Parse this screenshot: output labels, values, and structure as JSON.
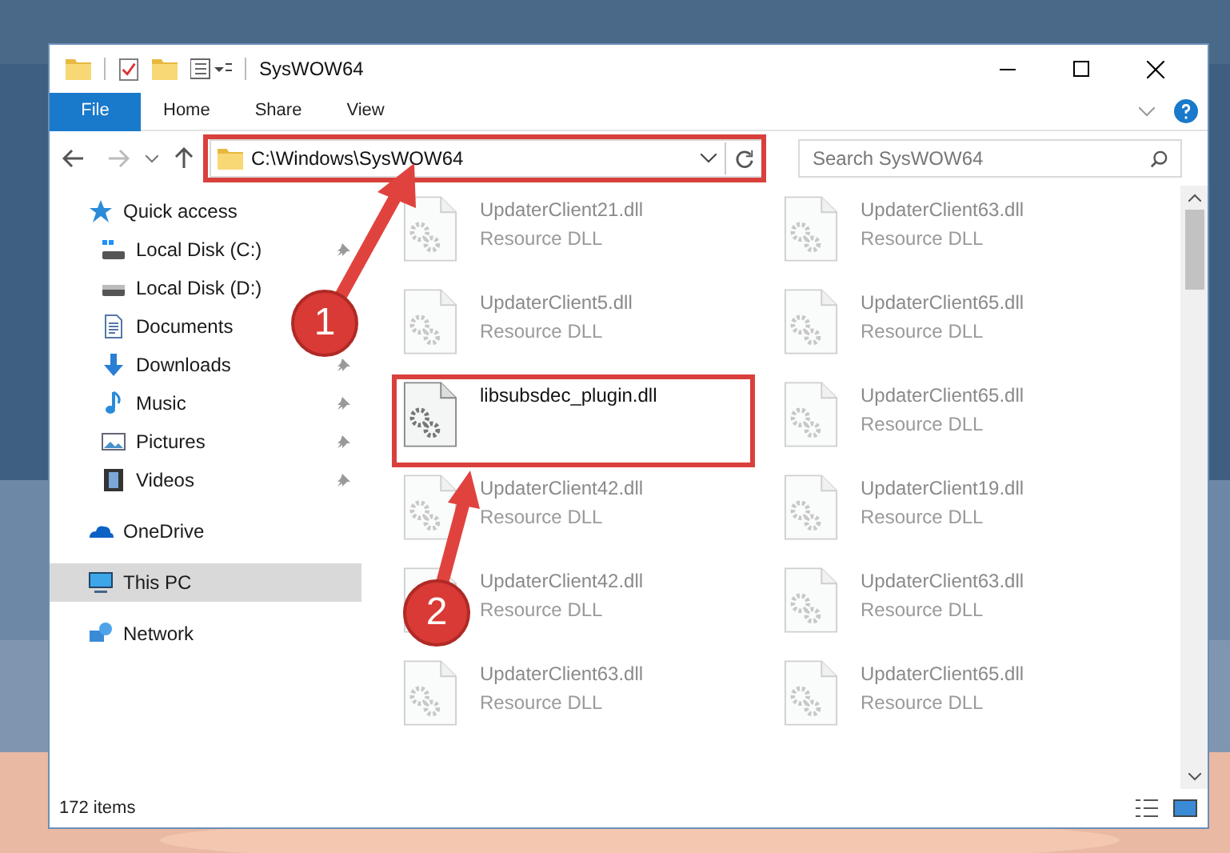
{
  "window": {
    "title": "SysWOW64"
  },
  "ribbon_tabs": [
    {
      "label": "File",
      "selected": true
    },
    {
      "label": "Home",
      "selected": false
    },
    {
      "label": "Share",
      "selected": false
    },
    {
      "label": "View",
      "selected": false
    }
  ],
  "address": {
    "path": "C:\\Windows\\SysWOW64",
    "highlighted": true
  },
  "search": {
    "placeholder": "Search SysWOW64"
  },
  "sidebar": {
    "items": [
      {
        "label": "Quick access",
        "selected": false,
        "children": [
          {
            "label": "Local Disk (C:)",
            "pinned": true,
            "selected": false
          },
          {
            "label": "Local Disk (D:)",
            "selected": false
          },
          {
            "label": "Documents",
            "selected": false
          },
          {
            "label": "Downloads",
            "pinned": true,
            "selected": false
          },
          {
            "label": "Music",
            "pinned": true,
            "selected": false
          },
          {
            "label": "Pictures",
            "pinned": true,
            "selected": false
          },
          {
            "label": "Videos",
            "pinned": true,
            "selected": false
          }
        ]
      },
      {
        "label": "OneDrive",
        "selected": false
      },
      {
        "label": "This PC",
        "selected": true
      },
      {
        "label": "Network",
        "selected": false
      }
    ]
  },
  "files": [
    {
      "name": "UpdaterClient21.dll",
      "type": "Resource DLL",
      "faded": true,
      "highlighted": false
    },
    {
      "name": "UpdaterClient63.dll",
      "type": "Resource DLL",
      "faded": true,
      "highlighted": false
    },
    {
      "name": "UpdaterClient5.dll",
      "type": "Resource DLL",
      "faded": true,
      "highlighted": false
    },
    {
      "name": "UpdaterClient65.dll",
      "type": "Resource DLL",
      "faded": true,
      "highlighted": false
    },
    {
      "name": "libsubsdec_plugin.dll",
      "faded": false,
      "highlighted": true
    },
    {
      "name": "UpdaterClient65.dll",
      "type": "Resource DLL",
      "faded": true,
      "highlighted": false
    },
    {
      "name": "UpdaterClient42.dll",
      "type": "Resource DLL",
      "faded": true,
      "highlighted": false
    },
    {
      "name": "UpdaterClient19.dll",
      "type": "Resource DLL",
      "faded": true,
      "highlighted": false
    },
    {
      "name": "UpdaterClient42.dll",
      "type": "Resource DLL",
      "faded": true,
      "highlighted": false
    },
    {
      "name": "UpdaterClient63.dll",
      "type": "Resource DLL",
      "faded": true,
      "highlighted": false
    },
    {
      "name": "UpdaterClient63.dll",
      "type": "Resource DLL",
      "faded": true,
      "highlighted": false
    },
    {
      "name": "UpdaterClient65.dll",
      "type": "Resource DLL",
      "faded": true,
      "highlighted": false
    }
  ],
  "status_bar": {
    "count": "172 items"
  },
  "annotations": [
    {
      "label": "1"
    },
    {
      "label": "2"
    }
  ]
}
